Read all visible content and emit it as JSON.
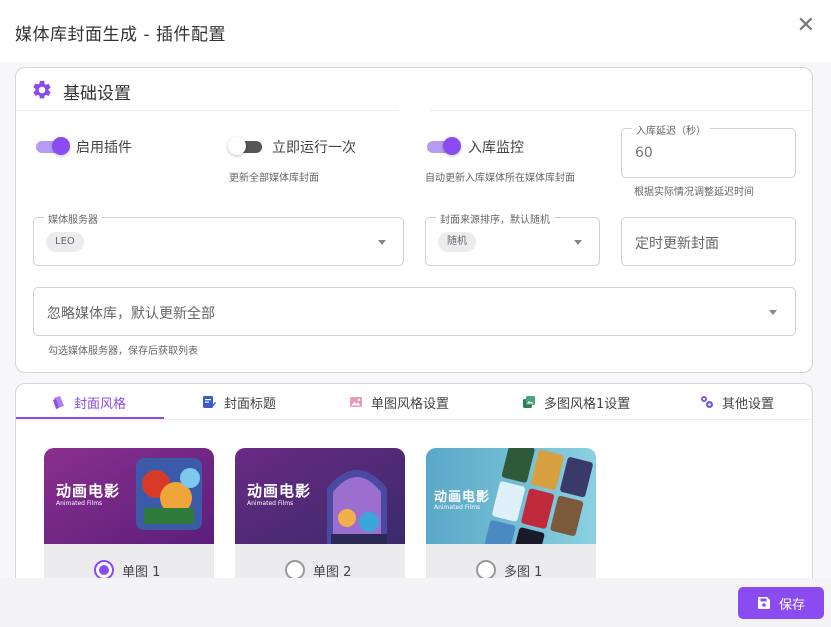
{
  "dialog": {
    "title": "媒体库封面生成 - 插件配置",
    "close_glyph": "✕"
  },
  "basic": {
    "title": "基础设置",
    "enable_plugin": {
      "label": "启用插件",
      "on": true
    },
    "run_once": {
      "label": "立即运行一次",
      "on": false,
      "hint": "更新全部媒体库封面"
    },
    "library_monitor": {
      "label": "入库监控",
      "on": true,
      "hint": "自动更新入库媒体所在媒体库封面"
    },
    "delay": {
      "label": "入库延迟（秒）",
      "value": "60",
      "hint": "根据实际情况调整延迟时间"
    },
    "media_server": {
      "label": "媒体服务器",
      "chip": "LEO"
    },
    "cover_sort": {
      "label": "封面来源排序，默认随机",
      "chip": "随机"
    },
    "cron": {
      "placeholder": "定时更新封面"
    },
    "exclude": {
      "placeholder": "忽略媒体库，默认更新全部",
      "hint": "勾选媒体服务器，保存后获取列表"
    }
  },
  "tabs": [
    {
      "label": "封面风格",
      "icon": "style-icon",
      "active": true
    },
    {
      "label": "封面标题",
      "icon": "title-edit-icon",
      "active": false
    },
    {
      "label": "单图风格设置",
      "icon": "single-image-icon",
      "active": false
    },
    {
      "label": "多图风格1设置",
      "icon": "multi-image-icon",
      "active": false
    },
    {
      "label": "其他设置",
      "icon": "gears-icon",
      "active": false
    }
  ],
  "styles": [
    {
      "label": "单图 1",
      "thumb_title": "动画电影",
      "thumb_sub": "Animated Films",
      "selected": true
    },
    {
      "label": "单图 2",
      "thumb_title": "动画电影",
      "thumb_sub": "Animated Films",
      "selected": false
    },
    {
      "label": "多图 1",
      "thumb_title": "动画电影",
      "thumb_sub": "Animated Films",
      "selected": false
    }
  ],
  "footer": {
    "save_label": "保存"
  },
  "colors": {
    "accent": "#8a4cf0",
    "accent_light": "#b79bf0"
  }
}
